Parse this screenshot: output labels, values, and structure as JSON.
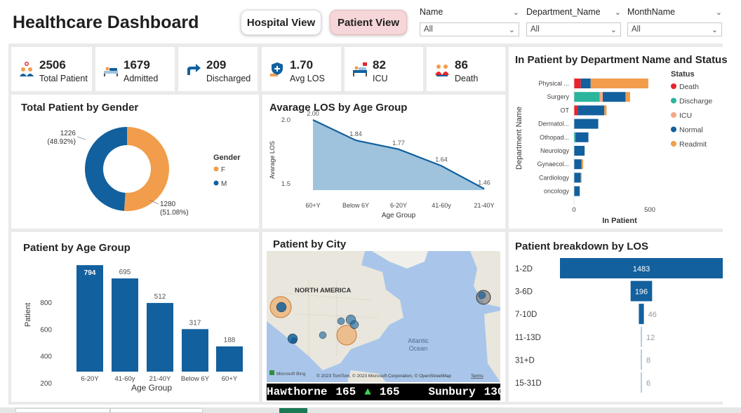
{
  "header": {
    "title": "Healthcare Dashboard",
    "hospital_view": "Hospital View",
    "patient_view": "Patient View"
  },
  "slicers": [
    {
      "label": "Name",
      "value": "All"
    },
    {
      "label": "Department_Name",
      "value": "All"
    },
    {
      "label": "MonthName",
      "value": "All"
    }
  ],
  "kpis": [
    {
      "value": "2506",
      "label": "Total Patient",
      "icon": "patients-icon"
    },
    {
      "value": "1679",
      "label": "Admitted",
      "icon": "hospital-bed-icon"
    },
    {
      "value": "209",
      "label": "Discharged",
      "icon": "discharge-arrow-icon"
    },
    {
      "value": "1.70",
      "label": "Avg LOS",
      "icon": "shield-hand-icon"
    },
    {
      "value": "82",
      "label": "ICU",
      "icon": "icu-bed-icon"
    },
    {
      "value": "86",
      "label": "Death",
      "icon": "mourning-icon"
    }
  ],
  "colors": {
    "blue": "#12609e",
    "orange": "#f19d4b",
    "red": "#e8232b",
    "teal": "#2ab59c",
    "salmon": "#f4a884",
    "area": "#9fc3dc",
    "light_bar": "#b5cde0"
  },
  "gender_card": {
    "title": "Total Patient by Gender",
    "legend_title": "Gender",
    "label_m": "1226",
    "label_m_pct": "(48.92%)",
    "label_f": "1280",
    "label_f_pct": "(51.08%)"
  },
  "los_age_card": {
    "title": "Avarage LOS by Age Group",
    "ylabel": "Avarage LOS",
    "xlabel": "Age Group"
  },
  "dept_card": {
    "title": "In Patient by Department Name and Status",
    "ylabel": "Department Name",
    "xlabel": "In Patient",
    "legend_title": "Status"
  },
  "age_card": {
    "title": "Patient by Age Group",
    "ylabel": "Patient",
    "xlabel": "Age Group"
  },
  "city_card": {
    "title": "Patient by City",
    "region_label": "NORTH AMERICA",
    "ocean_label_1": "Atlantic",
    "ocean_label_2": "Ocean",
    "bing": "Microsoft Bing",
    "attribution": "© 2023 TomTom, © 2023 Microsoft Corporation, © OpenStreetMap",
    "terms": "Terms",
    "ticker": [
      {
        "city": "Hawthorne",
        "value": "165",
        "arrow": "▲",
        "value2": "165"
      },
      {
        "city": "Sunbury",
        "value": "130"
      }
    ]
  },
  "los_card": {
    "title": "Patient breakdown by LOS"
  },
  "chart_data": [
    {
      "type": "pie",
      "title": "Total Patient by Gender",
      "legend_title": "Gender",
      "categories": [
        "F",
        "M"
      ],
      "values": [
        1280,
        1226
      ],
      "percent": [
        51.08,
        48.92
      ],
      "legend_position": "right"
    },
    {
      "type": "area",
      "title": "Avarage LOS by Age Group",
      "categories": [
        "60+Y",
        "Below 6Y",
        "6-20Y",
        "41-60y",
        "21-40Y"
      ],
      "values": [
        2.0,
        1.84,
        1.77,
        1.64,
        1.46
      ],
      "ylabel": "Avarage LOS",
      "xlabel": "Age Group",
      "yticks": [
        "2.0",
        "1.5"
      ],
      "ylim": [
        1.45,
        2.0
      ]
    },
    {
      "type": "bar",
      "orientation": "horizontal",
      "stacked": true,
      "title": "In Patient by Department Name and Status",
      "categories": [
        "Physical ...",
        "Surgery",
        "OT",
        "Dermatol...",
        "Othopad...",
        "Neurology",
        "Gynaecol...",
        "Cardiology",
        "oncology"
      ],
      "series": [
        {
          "name": "Death",
          "values": [
            45,
            0,
            25,
            0,
            0,
            0,
            0,
            0,
            0
          ]
        },
        {
          "name": "Discharge",
          "values": [
            0,
            170,
            0,
            0,
            10,
            0,
            0,
            0,
            0
          ]
        },
        {
          "name": "ICU",
          "values": [
            0,
            20,
            0,
            0,
            0,
            0,
            0,
            0,
            0
          ]
        },
        {
          "name": "Normal",
          "values": [
            65,
            150,
            175,
            160,
            85,
            70,
            50,
            45,
            38
          ]
        },
        {
          "name": "Readmit",
          "values": [
            380,
            30,
            15,
            0,
            0,
            0,
            10,
            5,
            0
          ]
        }
      ],
      "xticks": [
        "0",
        "500"
      ],
      "xlim": [
        0,
        500
      ],
      "ylabel": "Department Name",
      "xlabel": "In Patient",
      "legend_title": "Status",
      "legend_position": "right"
    },
    {
      "type": "bar",
      "title": "Patient by Age Group",
      "categories": [
        "6-20Y",
        "41-60y",
        "21-40Y",
        "Below 6Y",
        "60+Y"
      ],
      "values": [
        794,
        695,
        512,
        317,
        188
      ],
      "ylabel": "Patient",
      "xlabel": "Age Group",
      "yticks": [
        "800",
        "600",
        "400",
        "200",
        "0"
      ],
      "ylim": [
        0,
        800
      ]
    },
    {
      "type": "bar",
      "title": "Patient breakdown by LOS",
      "chart_style": "funnel",
      "categories": [
        "1-2D",
        "3-6D",
        "7-10D",
        "11-13D",
        "31+D",
        "15-31D"
      ],
      "values": [
        1483,
        196,
        46,
        12,
        8,
        6
      ]
    }
  ]
}
